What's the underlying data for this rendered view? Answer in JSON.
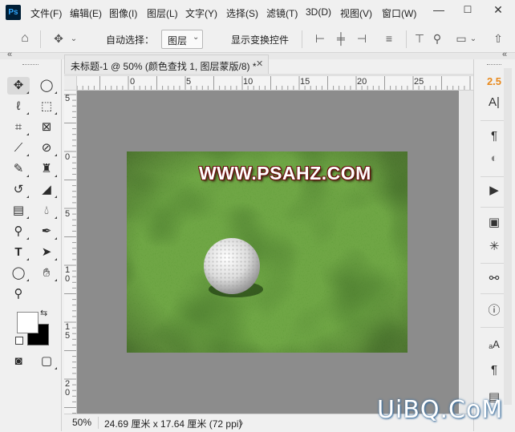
{
  "app": {
    "logo": "Ps"
  },
  "menu": [
    "文件(F)",
    "编辑(E)",
    "图像(I)",
    "图层(L)",
    "文字(Y)",
    "选择(S)",
    "滤镜(T)",
    "3D(D)",
    "视图(V)",
    "窗口(W)"
  ],
  "window_controls": {
    "minimize": "—",
    "maximize": "☐",
    "close": "✕"
  },
  "options_bar": {
    "auto_select_label": "自动选择：",
    "layer_select_value": "图层",
    "show_transform_label": "显示变换控件"
  },
  "collapse_marker": "«",
  "document_tab": {
    "title": "未标题-1 @ 50% (颜色查找 1, 图层蒙版/8) *",
    "close": "✕"
  },
  "ruler_top": {
    "labels": [
      "0",
      "5",
      "10",
      "15",
      "20",
      "25"
    ]
  },
  "ruler_left": {
    "labels": [
      "5",
      "0",
      "5",
      "1\n0",
      "1\n5",
      "2\n0"
    ]
  },
  "canvas": {
    "overlay_text": "WWW.PSAHZ.COM",
    "background_color": "#8c8c8c"
  },
  "status_bar": {
    "zoom": "50%",
    "doc_info": "24.69 厘米 x 17.64 厘米 (72 ppi)",
    "arrow": "〉"
  },
  "right_panel": {
    "adjust_value": "2.5"
  },
  "watermark": "UiBQ.CoM",
  "colors": {
    "accent_ps": "#31a8ff",
    "ps_bg": "#001e36",
    "grass_dark": "#2a5a10",
    "grass_light": "#5aa028"
  }
}
